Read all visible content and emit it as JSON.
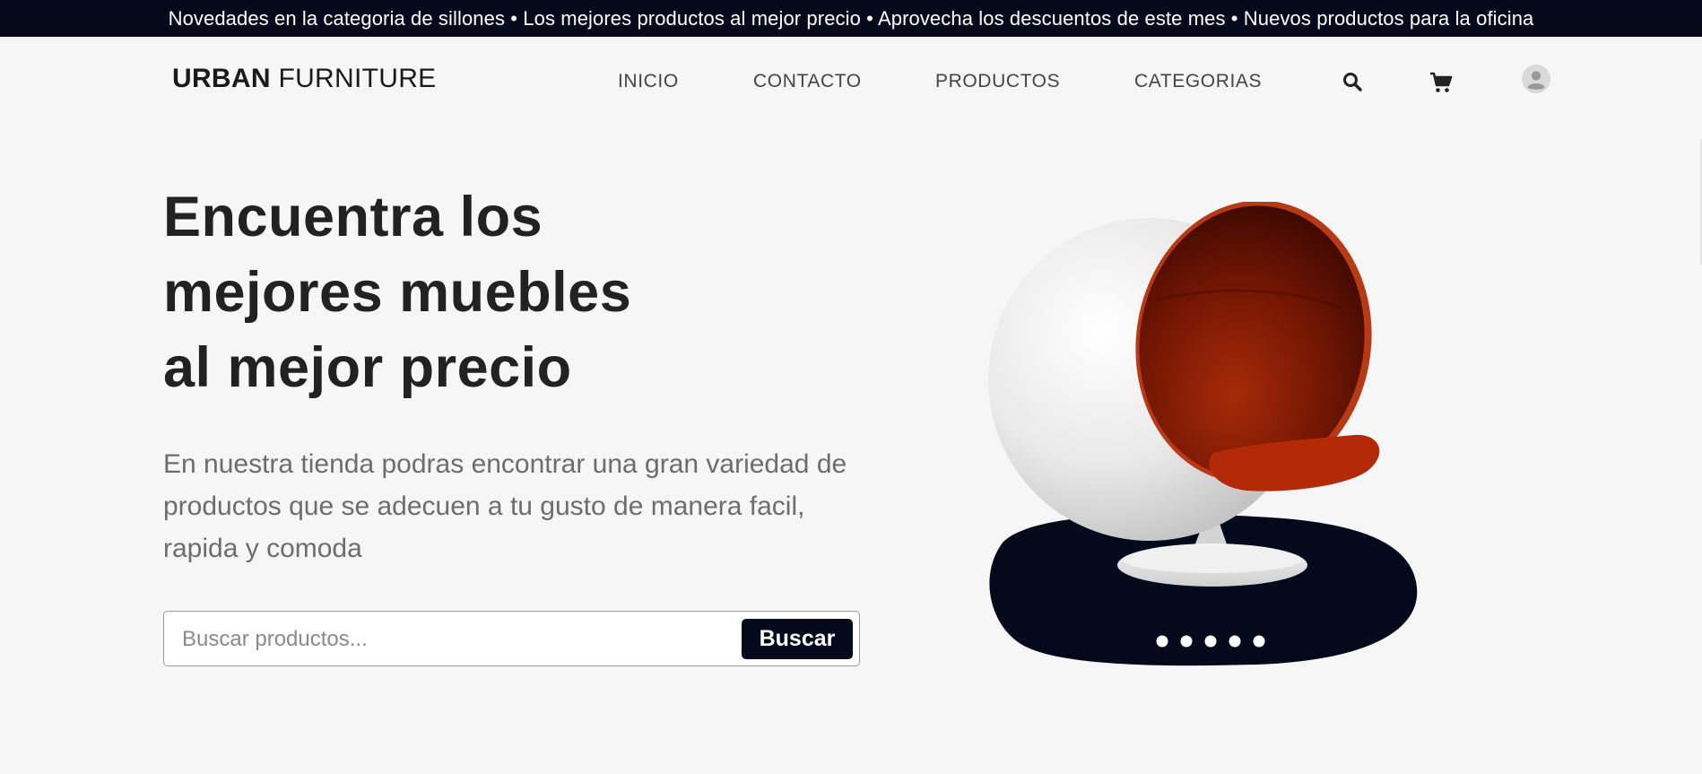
{
  "announcement": {
    "text": "Novedades en la categoria de sillones • Los mejores productos al mejor precio • Aprovecha los descuentos de este mes • Nuevos productos para la oficina"
  },
  "brand": {
    "strong": "URBAN",
    "light": " FURNITURE"
  },
  "nav": {
    "items": [
      {
        "label": "INICIO"
      },
      {
        "label": "CONTACTO"
      },
      {
        "label": "PRODUCTOS"
      },
      {
        "label": "CATEGORIAS"
      }
    ],
    "icons": [
      "search-icon",
      "cart-icon",
      "user-avatar-icon"
    ]
  },
  "hero": {
    "title_lines": [
      "Encuentra los",
      "mejores muebles",
      "al mejor precio"
    ],
    "description_lines": [
      "En nuestra tienda podras encontrar una gran variedad de",
      "productos que se adecuen a tu gusto de manera facil,",
      "rapida y comoda"
    ]
  },
  "search": {
    "placeholder": "Buscar productos...",
    "value": "",
    "button_label": "Buscar"
  },
  "carousel": {
    "image": "ball-chair",
    "dot_count": 5
  },
  "colors": {
    "dark": "#040a1c",
    "background": "#f6f6f6",
    "chair_interior": "#8a1e05"
  }
}
